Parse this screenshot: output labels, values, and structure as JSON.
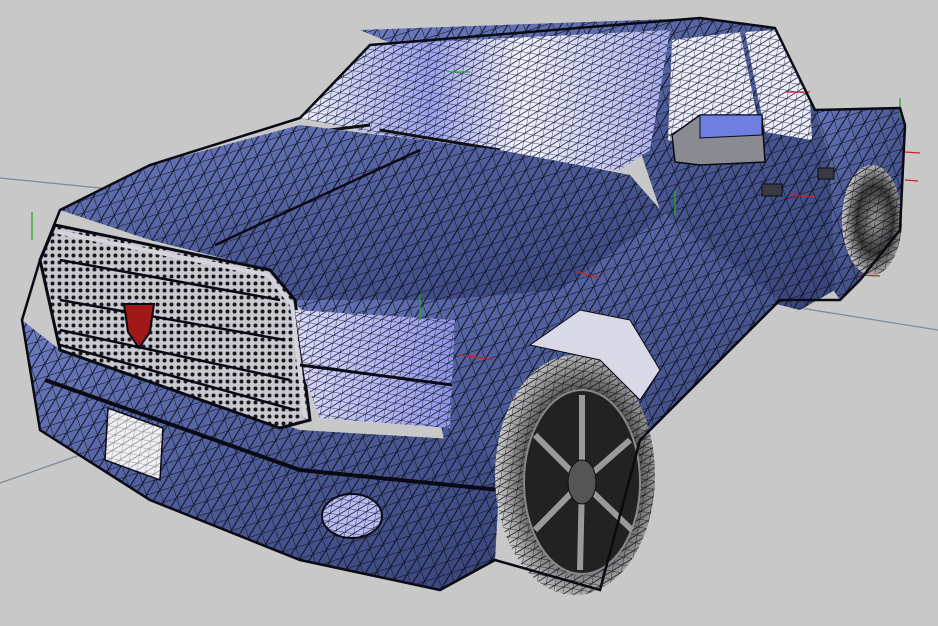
{
  "viewport": {
    "background_color": "#c8c8c8",
    "render_mode": "wireframe-shaded",
    "wire_color": "#0a0a14"
  },
  "model": {
    "subject": "pickup truck",
    "body_color": "#5a6aa8",
    "body_highlight_color": "#b8bcf4",
    "glass_color": "#d8dcff",
    "tire_color": "#2a2a2a",
    "emblem_color": "#a01818"
  },
  "axes": {
    "x_axis_color": "#cc2222",
    "y_axis_color": "#22aa22",
    "guide_line_color": "#7a8a9a"
  }
}
